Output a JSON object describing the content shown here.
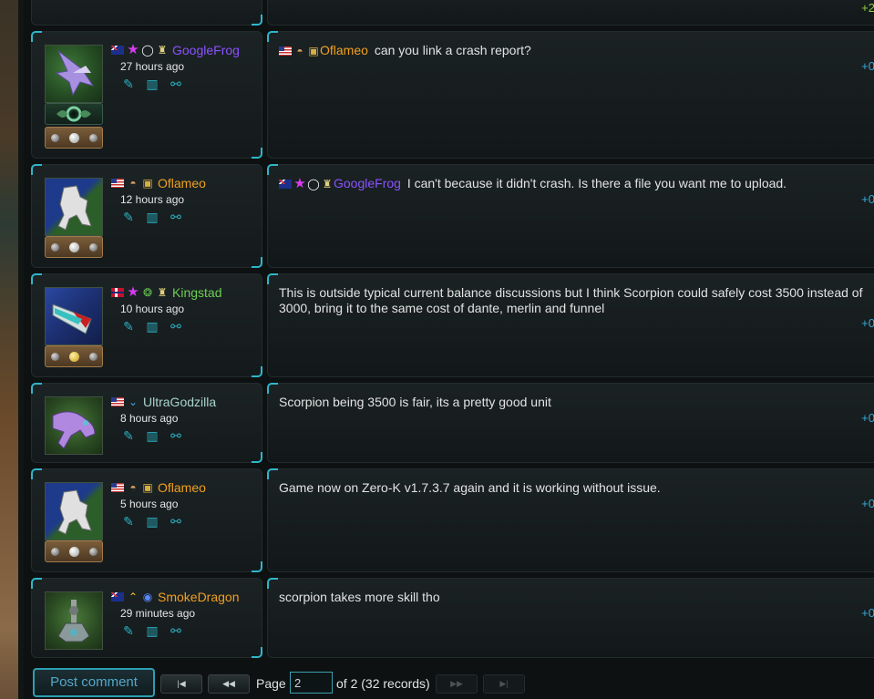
{
  "posts": [
    {
      "id": "p0",
      "vote": "+2",
      "vote_color": "#8ad040"
    },
    {
      "id": "p1",
      "username": "GoogleFrog",
      "time": "27 hours ago",
      "message": "can you link a crash report?",
      "quote_user": "Oflameo",
      "vote": "+0"
    },
    {
      "id": "p2",
      "username": "Oflameo",
      "time": "12 hours ago",
      "message": "I can't because it didn't crash. Is there a file you want me to upload.",
      "quote_user": "GoogleFrog",
      "vote": "+0"
    },
    {
      "id": "p3",
      "username": "Kingstad",
      "time": "10 hours ago",
      "message": "This is outside typical current balance discussions but I think Scorpion could safely cost 3500 instead of 3000, bring it to the same cost of dante, merlin and funnel",
      "vote": "+0"
    },
    {
      "id": "p4",
      "username": "UltraGodzilla",
      "time": "8 hours ago",
      "message": "Scorpion being 3500 is fair, its a pretty good unit",
      "vote": "+0"
    },
    {
      "id": "p5",
      "username": "Oflameo",
      "time": "5 hours ago",
      "message": "Game now on Zero-K v1.7.3.7 again and it is working without issue.",
      "vote": "+0"
    },
    {
      "id": "p6",
      "username": "SmokeDragon",
      "time": "29 minutes ago",
      "message": "scorpion takes more skill tho",
      "vote": "+0"
    }
  ],
  "pager": {
    "post_comment": "Post comment",
    "first": "|◀",
    "prev": "◀◀",
    "next": "▶▶",
    "last": "▶|",
    "page_label": "Page",
    "page_value": "2",
    "of_text": "of 2 (32 records)"
  },
  "colors": {
    "accent": "#2fb6c9",
    "name_purple": "#8a52ff",
    "name_orange": "#f0a020",
    "name_green": "#6ecf52",
    "name_light": "#a8d2cc"
  },
  "icons": {
    "edit": "pencil-icon",
    "delete": "trash-icon",
    "link": "link-icon"
  }
}
